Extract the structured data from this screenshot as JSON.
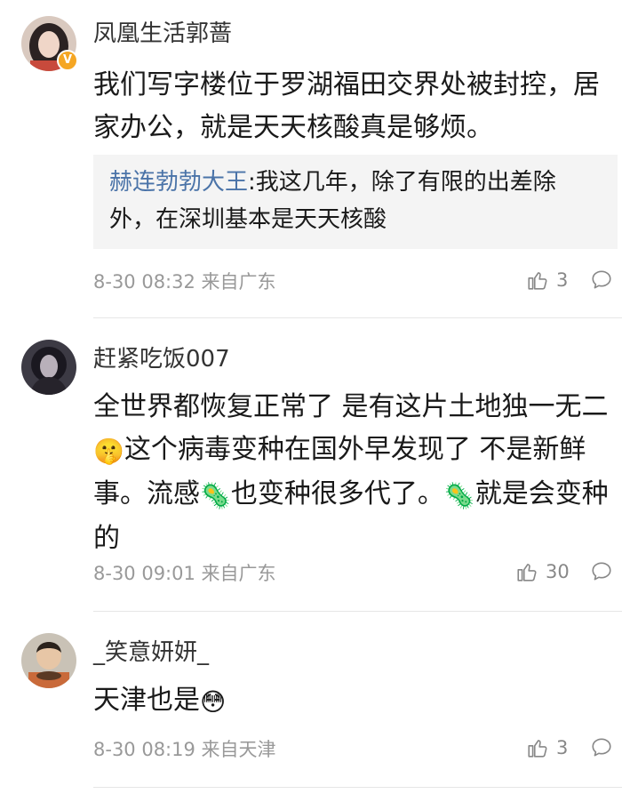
{
  "comments": [
    {
      "username": "凤凰生活郭蔷",
      "verified_badge": "V",
      "text": "我们写字楼位于罗湖福田交界处被封控，居家办公，就是天天核酸真是够烦。",
      "quote": {
        "user": "赫连勃勃大王",
        "text": ":我这几年，除了有限的出差除外，在深圳基本是天天核酸"
      },
      "time": "8-30 08:32",
      "source": "来自广东",
      "likes": "3"
    },
    {
      "username": "赶紧吃饭007",
      "text_parts": {
        "a": "全世界都恢复正常了 是有这片土地独一无二",
        "b": "这个病毒变种在国外早发现了 不是新鲜事。流感",
        "c": "也变种很多代了。",
        "d": "就是会变种的"
      },
      "emojis": {
        "shush": "🤫",
        "microbe": "🦠"
      },
      "time": "8-30 09:01",
      "source": "来自广东",
      "likes": "30"
    },
    {
      "username": "_笑意妍妍_",
      "text": "天津也是",
      "emoji": "😳",
      "time": "8-30 08:19",
      "source": "来自天津",
      "likes": "3"
    }
  ]
}
